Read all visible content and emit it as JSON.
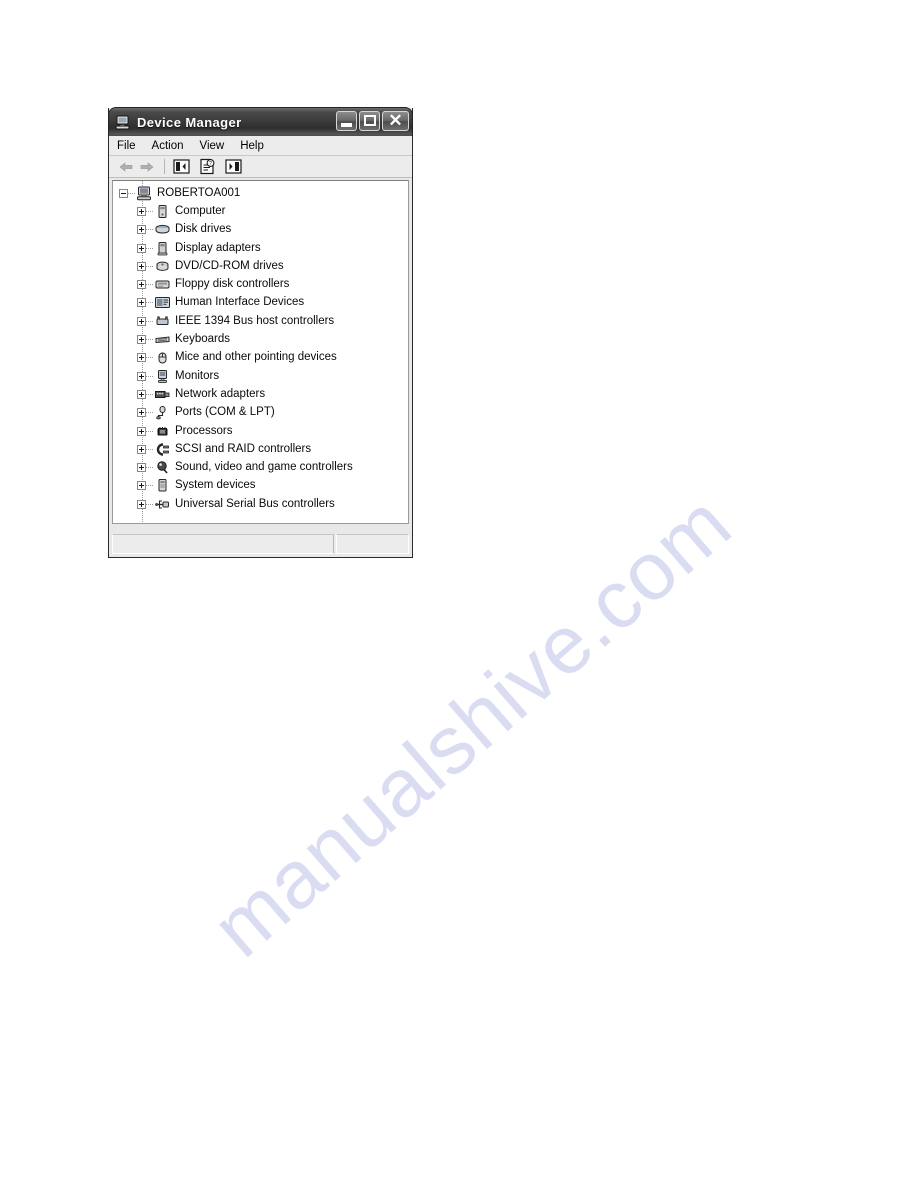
{
  "page": {
    "watermark_text": "manualshive.com",
    "watermark_color": "#d9dcf2",
    "background_color": "#ffffff"
  },
  "window": {
    "title": "Device Manager",
    "title_icon": "computer-icon",
    "title_bar_color": "#3a3a3a",
    "buttons": {
      "minimize_label": "Minimize",
      "maximize_label": "Maximize",
      "close_label": "Close",
      "close_glyph": "✕"
    }
  },
  "menu": {
    "items": [
      {
        "label": "File",
        "name": "menu-file"
      },
      {
        "label": "Action",
        "name": "menu-action"
      },
      {
        "label": "View",
        "name": "menu-view"
      },
      {
        "label": "Help",
        "name": "menu-help"
      }
    ]
  },
  "toolbar": {
    "back_label": "Back",
    "forward_label": "Forward",
    "buttons": [
      {
        "name": "show-hide-console-tree-button",
        "label": "Show/Hide Console Tree",
        "icon": "panel-left-icon"
      },
      {
        "name": "properties-button",
        "label": "Properties",
        "icon": "properties-icon"
      },
      {
        "name": "help-button",
        "label": "Help",
        "icon": "panel-right-icon"
      }
    ]
  },
  "tree": {
    "root": {
      "label": "ROBERTOA001",
      "icon": "computer-node-icon",
      "expanded": true
    },
    "nodes": [
      {
        "label": "Computer",
        "icon": "computer-icon"
      },
      {
        "label": "Disk drives",
        "icon": "disk-drive-icon"
      },
      {
        "label": "Display adapters",
        "icon": "display-adapter-icon"
      },
      {
        "label": "DVD/CD-ROM drives",
        "icon": "optical-drive-icon"
      },
      {
        "label": "Floppy disk controllers",
        "icon": "floppy-controller-icon"
      },
      {
        "label": "Human Interface Devices",
        "icon": "hid-icon"
      },
      {
        "label": "IEEE 1394 Bus host controllers",
        "icon": "firewire-icon"
      },
      {
        "label": "Keyboards",
        "icon": "keyboard-icon"
      },
      {
        "label": "Mice and other pointing devices",
        "icon": "mouse-icon"
      },
      {
        "label": "Monitors",
        "icon": "monitor-icon"
      },
      {
        "label": "Network adapters",
        "icon": "network-adapter-icon"
      },
      {
        "label": "Ports (COM & LPT)",
        "icon": "port-icon"
      },
      {
        "label": "Processors",
        "icon": "processor-icon"
      },
      {
        "label": "SCSI and RAID controllers",
        "icon": "scsi-raid-icon"
      },
      {
        "label": "Sound, video and game controllers",
        "icon": "sound-icon"
      },
      {
        "label": "System devices",
        "icon": "system-device-icon"
      },
      {
        "label": "Universal Serial Bus controllers",
        "icon": "usb-icon"
      }
    ]
  },
  "status_bar": {
    "left_text": "",
    "right_text": ""
  }
}
